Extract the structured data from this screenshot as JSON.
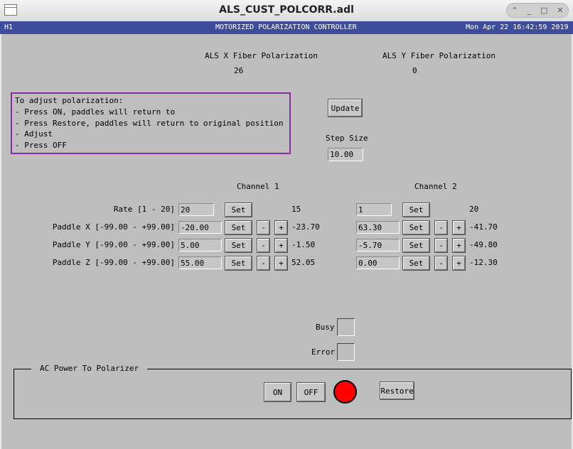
{
  "window": {
    "title": "ALS_CUST_POLCORR.adl",
    "controls": [
      "⌃",
      "_",
      "□",
      "✕"
    ]
  },
  "banner": {
    "left": "H1",
    "center": "MOTORIZED POLARIZATION CONTROLLER",
    "right": "Mon Apr 22 16:42:59 2019"
  },
  "fiber": {
    "x_label": "ALS X Fiber Polarization",
    "x_value": "26",
    "y_label": "ALS Y Fiber Polarization",
    "y_value": "0"
  },
  "instructions": [
    "To adjust polarization:",
    " - Press ON, paddles will return to",
    " - Press Restore, paddles will return to original position",
    " - Adjust",
    " - Press OFF"
  ],
  "update_label": "Update",
  "step": {
    "label": "Step Size",
    "value": "10.00"
  },
  "channels": {
    "ch1_title": "Channel 1",
    "ch2_title": "Channel 2"
  },
  "rows": [
    {
      "label": "Rate [1 - 20]",
      "ch1_input": "20",
      "ch1_readback": "15",
      "ch2_input": "1",
      "ch2_readback": "20",
      "steppers": false
    },
    {
      "label": "Paddle X [-99.00 - +99.00]",
      "ch1_input": "-20.00",
      "ch1_readback": "-23.70",
      "ch2_input": "63.30",
      "ch2_readback": "-41.70",
      "steppers": true
    },
    {
      "label": "Paddle Y [-99.00 - +99.00]",
      "ch1_input": "5.00",
      "ch1_readback": "-1.50",
      "ch2_input": "-5.70",
      "ch2_readback": "-49.80",
      "steppers": true
    },
    {
      "label": "Paddle Z [-99.00 - +99.00]",
      "ch1_input": "55.00",
      "ch1_readback": "52.05",
      "ch2_input": "0.00",
      "ch2_readback": "-12.30",
      "steppers": true
    }
  ],
  "buttons": {
    "set": "Set",
    "minus": "-",
    "plus": "+"
  },
  "status": {
    "busy": "Busy",
    "error": "Error"
  },
  "ac_power": {
    "title": "AC Power To Polarizer",
    "on": "ON",
    "off": "OFF",
    "restore": "Restore",
    "indicator_color": "#ff0000"
  },
  "colors": {
    "banner_bg": "#3e4c9c",
    "panel_bg": "#bebebe",
    "instructions_border": "#8a2ca0"
  }
}
